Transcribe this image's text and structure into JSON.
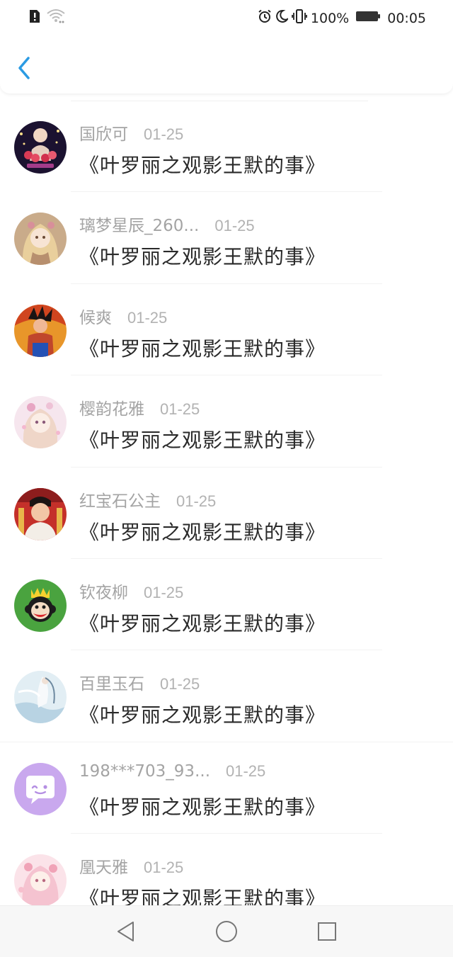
{
  "status_bar": {
    "battery": "100%",
    "time": "00:05",
    "icons": [
      "sim-alert-icon",
      "wifi-icon",
      "alarm-icon",
      "moon-icon",
      "vibrate-icon",
      "battery-icon"
    ]
  },
  "header": {
    "back_icon": "chevron-left-icon",
    "accent_color": "#2b9be3"
  },
  "items": [
    {
      "name": "国欣可",
      "date": "01-25",
      "title": "《叶罗丽之观影王默的事》",
      "avatar": "avatar-red-flowers"
    },
    {
      "name": "璃梦星辰_260...",
      "date": "01-25",
      "title": "《叶罗丽之观影王默的事》",
      "avatar": "avatar-anime-girl-gold"
    },
    {
      "name": "候爽",
      "date": "01-25",
      "title": "《叶罗丽之观影王默的事》",
      "avatar": "avatar-anime-fighter"
    },
    {
      "name": "樱韵花雅",
      "date": "01-25",
      "title": "《叶罗丽之观影王默的事》",
      "avatar": "avatar-anime-girl-pink"
    },
    {
      "name": "红宝石公主",
      "date": "01-25",
      "title": "《叶罗丽之观影王默的事》",
      "avatar": "avatar-person-red"
    },
    {
      "name": "钦夜柳",
      "date": "01-25",
      "title": "《叶罗丽之观影王默的事》",
      "avatar": "avatar-monkey-crown"
    },
    {
      "name": "百里玉石",
      "date": "01-25",
      "title": "《叶罗丽之观影王默的事》",
      "avatar": "avatar-anime-white"
    },
    {
      "name": "198***703_93...",
      "date": "01-25",
      "title": "《叶罗丽之观影王默的事》",
      "avatar": "avatar-default-chat"
    },
    {
      "name": "凰天雅",
      "date": "01-25",
      "title": "《叶罗丽之观影王默的事》",
      "avatar": "avatar-anime-girl-pink2"
    }
  ],
  "nav_bar": {
    "buttons": [
      "back-triangle-icon",
      "home-circle-icon",
      "recents-square-icon"
    ]
  }
}
